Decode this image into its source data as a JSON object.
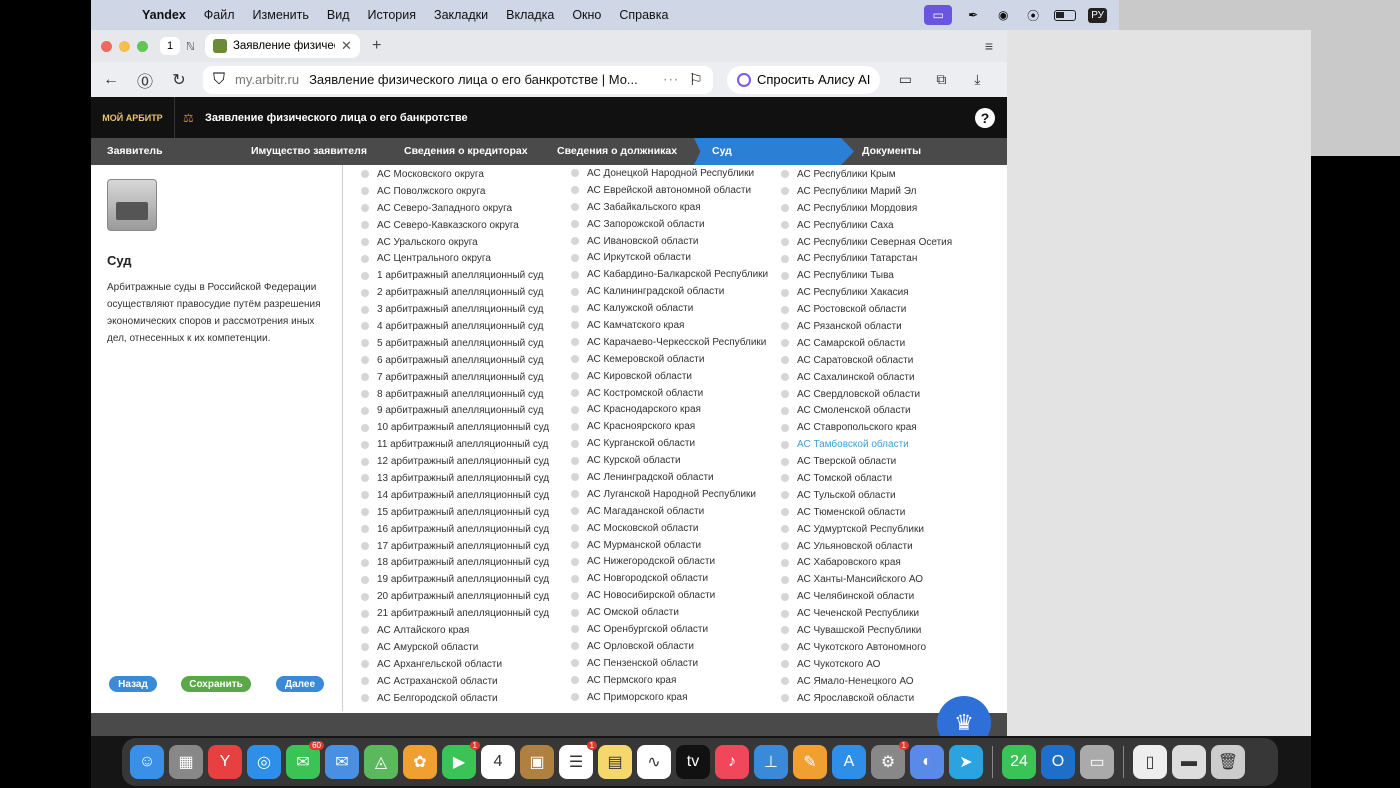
{
  "menubar": {
    "app": "Yandex",
    "items": [
      "Файл",
      "Изменить",
      "Вид",
      "История",
      "Закладки",
      "Вкладка",
      "Окно",
      "Справка"
    ],
    "lang": "РУ"
  },
  "browser": {
    "tab_count": "1",
    "tab_title": "Заявление физическо",
    "url_host": "my.arbitr.ru",
    "url_title": "Заявление физического лица о его банкротстве | Мо...",
    "alisa": "Спросить Алису AI"
  },
  "site": {
    "logo": "МОЙ АРБИТР",
    "header_title": "Заявление физического лица о его банкротстве",
    "help": "?",
    "steps": [
      "Заявитель",
      "Имущество заявителя",
      "Сведения о кредиторах",
      "Сведения о должниках",
      "Суд",
      "Документы"
    ],
    "active_step": "Суд",
    "court_title": "Суд",
    "court_desc": "Арбитражные суды в Российской Федерации осуществляют правосудие путём разрешения экономических споров и рассмотрения иных дел, отнесенных к их компетенции.",
    "buttons": {
      "back": "Назад",
      "save": "Сохранить",
      "next": "Далее"
    },
    "col1": [
      "АС Московского округа",
      "АС Поволжского округа",
      "АС Северо-Западного округа",
      "АС Северо-Кавказского округа",
      "АС Уральского округа",
      "АС Центрального округа",
      "1 арбитражный апелляционный суд",
      "2 арбитражный апелляционный суд",
      "3 арбитражный апелляционный суд",
      "4 арбитражный апелляционный суд",
      "5 арбитражный апелляционный суд",
      "6 арбитражный апелляционный суд",
      "7 арбитражный апелляционный суд",
      "8 арбитражный апелляционный суд",
      "9 арбитражный апелляционный суд",
      "10 арбитражный апелляционный суд",
      "11 арбитражный апелляционный суд",
      "12 арбитражный апелляционный суд",
      "13 арбитражный апелляционный суд",
      "14 арбитражный апелляционный суд",
      "15 арбитражный апелляционный суд",
      "16 арбитражный апелляционный суд",
      "17 арбитражный апелляционный суд",
      "18 арбитражный апелляционный суд",
      "19 арбитражный апелляционный суд",
      "20 арбитражный апелляционный суд",
      "21 арбитражный апелляционный суд",
      "АС Алтайского края",
      "АС Амурской области",
      "АС Архангельской области",
      "АС Астраханской области",
      "АС Белгородской области"
    ],
    "col2": [
      "АС Донецкой Народной Республики",
      "АС Еврейской автономной области",
      "АС Забайкальского края",
      "АС Запорожской области",
      "АС Ивановской области",
      "АС Иркутской области",
      "АС Кабардино-Балкарской Республики",
      "АС Калининградской области",
      "АС Калужской области",
      "АС Камчатского края",
      "АС Карачаево-Черкесской Республики",
      "АС Кемеровской области",
      "АС Кировской области",
      "АС Костромской области",
      "АС Краснодарского края",
      "АС Красноярского края",
      "АС Курганской области",
      "АС Курской области",
      "АС Ленинградской области",
      "АС Луганской Народной Республики",
      "АС Магаданской области",
      "АС Московской области",
      "АС Мурманской области",
      "АС Нижегородской области",
      "АС Новгородской области",
      "АС Новосибирской области",
      "АС Омской области",
      "АС Оренбургской области",
      "АС Орловской области",
      "АС Пензенской области",
      "АС Пермского края",
      "АС Приморского края"
    ],
    "col3": [
      "АС Республики Крым",
      "АС Республики Марий Эл",
      "АС Республики Мордовия",
      "АС Республики Саха",
      "АС Республики Северная Осетия",
      "АС Республики Татарстан",
      "АС Республики Тыва",
      "АС Республики Хакасия",
      "АС Ростовской области",
      "АС Рязанской области",
      "АС Самарской области",
      "АС Саратовской области",
      "АС Сахалинской области",
      "АС Свердловской области",
      "АС Смоленской области",
      "АС Ставропольского края",
      "АС Тамбовской области",
      "АС Тверской области",
      "АС Томской области",
      "АС Тульской области",
      "АС Тюменской области",
      "АС Удмуртской Республики",
      "АС Ульяновской области",
      "АС Хабаровского края",
      "АС Ханты-Мансийского АО",
      "АС Челябинской области",
      "АС Чеченской Республики",
      "АС Чувашской Республики",
      "АС Чукотского Автономного",
      "АС Чукотского АО",
      "АС Ямало-Ненецкого АО",
      "АС Ярославской области"
    ],
    "highlighted": "АС Тамбовской области"
  },
  "dock": {
    "apps": [
      {
        "name": "finder-icon",
        "color": "#3b8fe6",
        "glyph": "☺"
      },
      {
        "name": "launchpad-icon",
        "color": "#888",
        "glyph": "▦"
      },
      {
        "name": "yandex-browser-icon",
        "color": "#e84040",
        "glyph": "Y"
      },
      {
        "name": "safari-icon",
        "color": "#2f8fe8",
        "glyph": "◎"
      },
      {
        "name": "messages-icon",
        "color": "#3cc356",
        "glyph": "✉",
        "badge": "60"
      },
      {
        "name": "mail-icon",
        "color": "#4a90e2",
        "glyph": "✉"
      },
      {
        "name": "maps-icon",
        "color": "#5cb85c",
        "glyph": "◬"
      },
      {
        "name": "photos-icon",
        "color": "#f0a030",
        "glyph": "✿"
      },
      {
        "name": "facetime-icon",
        "color": "#3cc356",
        "glyph": "▶",
        "badge": "1"
      },
      {
        "name": "calendar-icon",
        "color": "#fff",
        "glyph": "4"
      },
      {
        "name": "contacts-icon",
        "color": "#b08040",
        "glyph": "▣"
      },
      {
        "name": "reminders-icon",
        "color": "#fff",
        "glyph": "☰",
        "badge": "1"
      },
      {
        "name": "notes-icon",
        "color": "#f5d76e",
        "glyph": "▤"
      },
      {
        "name": "freeform-icon",
        "color": "#fff",
        "glyph": "∿"
      },
      {
        "name": "tv-icon",
        "color": "#111",
        "glyph": "tv"
      },
      {
        "name": "music-icon",
        "color": "#f0485a",
        "glyph": "♪"
      },
      {
        "name": "keynote-icon",
        "color": "#3a8ad8",
        "glyph": "⊥"
      },
      {
        "name": "pages-icon",
        "color": "#f0a030",
        "glyph": "✎"
      },
      {
        "name": "app-store-icon",
        "color": "#2f8fe8",
        "glyph": "A"
      },
      {
        "name": "settings-icon",
        "color": "#888",
        "glyph": "⚙",
        "badge": "1"
      },
      {
        "name": "cleaner-icon",
        "color": "#5a8ae8",
        "glyph": "◐"
      },
      {
        "name": "telegram-icon",
        "color": "#2aa3e0",
        "glyph": "➤"
      },
      {
        "name": "calendar-24-icon",
        "color": "#3cc356",
        "glyph": "24"
      },
      {
        "name": "outlook-icon",
        "color": "#1f6fc8",
        "glyph": "O"
      },
      {
        "name": "screen-icon",
        "color": "#aaa",
        "glyph": "▭"
      },
      {
        "name": "document-icon",
        "color": "#eee",
        "glyph": "▯"
      },
      {
        "name": "folder-icon",
        "color": "#ddd",
        "glyph": "▬"
      },
      {
        "name": "trash-icon",
        "color": "#ccc",
        "glyph": "🗑"
      }
    ]
  }
}
